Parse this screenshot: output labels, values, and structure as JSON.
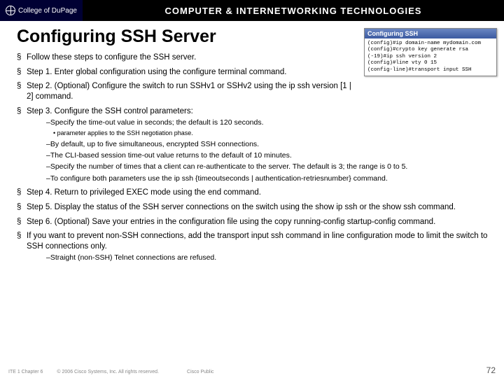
{
  "header": {
    "college": "College of DuPage",
    "course_title": "COMPUTER & INTERNETWORKING TECHNOLOGIES"
  },
  "slide": {
    "title": "Configuring SSH Server"
  },
  "ssh_box": {
    "title": "Configuring SSH",
    "lines": "(config)#ip domain-name mydomain.com\n(config)#crypto key generate rsa\n(-19)#ip ssh version 2\n(config)#line vty 0 15\n(config-line)#transport input SSH"
  },
  "bullets": {
    "b0": "Follow these steps to configure the SSH server.",
    "b1": "Step 1. Enter global configuration using the configure terminal command.",
    "b2": "Step 2. (Optional) Configure the switch to run SSHv1 or SSHv2 using the ip ssh version [1 | 2] command.",
    "b3": "Step 3. Configure the SSH control parameters:",
    "b3_sub1": "–Specify the time-out value in seconds; the default is 120 seconds.",
    "b3_sub1a": "• parameter applies to the SSH negotiation phase.",
    "b3_sub2": "–By default, up to five simultaneous, encrypted SSH connections.",
    "b3_sub3": "–The CLI-based session time-out value returns to the default of 10 minutes.",
    "b3_sub4": "–Specify the number of times that a client can re-authenticate to the server. The default is 3; the range is 0 to 5.",
    "b3_sub5": "–To configure both parameters use the ip ssh {timeoutseconds | authentication-retriesnumber} command.",
    "b4": "Step 4. Return to privileged EXEC mode using the end command.",
    "b5": "Step 5. Display the status of the SSH server connections on the switch using the show ip ssh or the show ssh command.",
    "b6": "Step 6. (Optional) Save your entries in the configuration file using the copy running-config startup-config command.",
    "b7": "If you want to prevent non-SSH connections, add the transport input ssh command in line configuration mode to limit the switch to SSH connections only.",
    "b7_sub1": "–Straight (non-SSH) Telnet connections are refused."
  },
  "footer": {
    "left": "ITE 1 Chapter 6",
    "mid": "© 2006 Cisco Systems, Inc. All rights reserved.",
    "pub": "Cisco Public",
    "page": "72"
  }
}
